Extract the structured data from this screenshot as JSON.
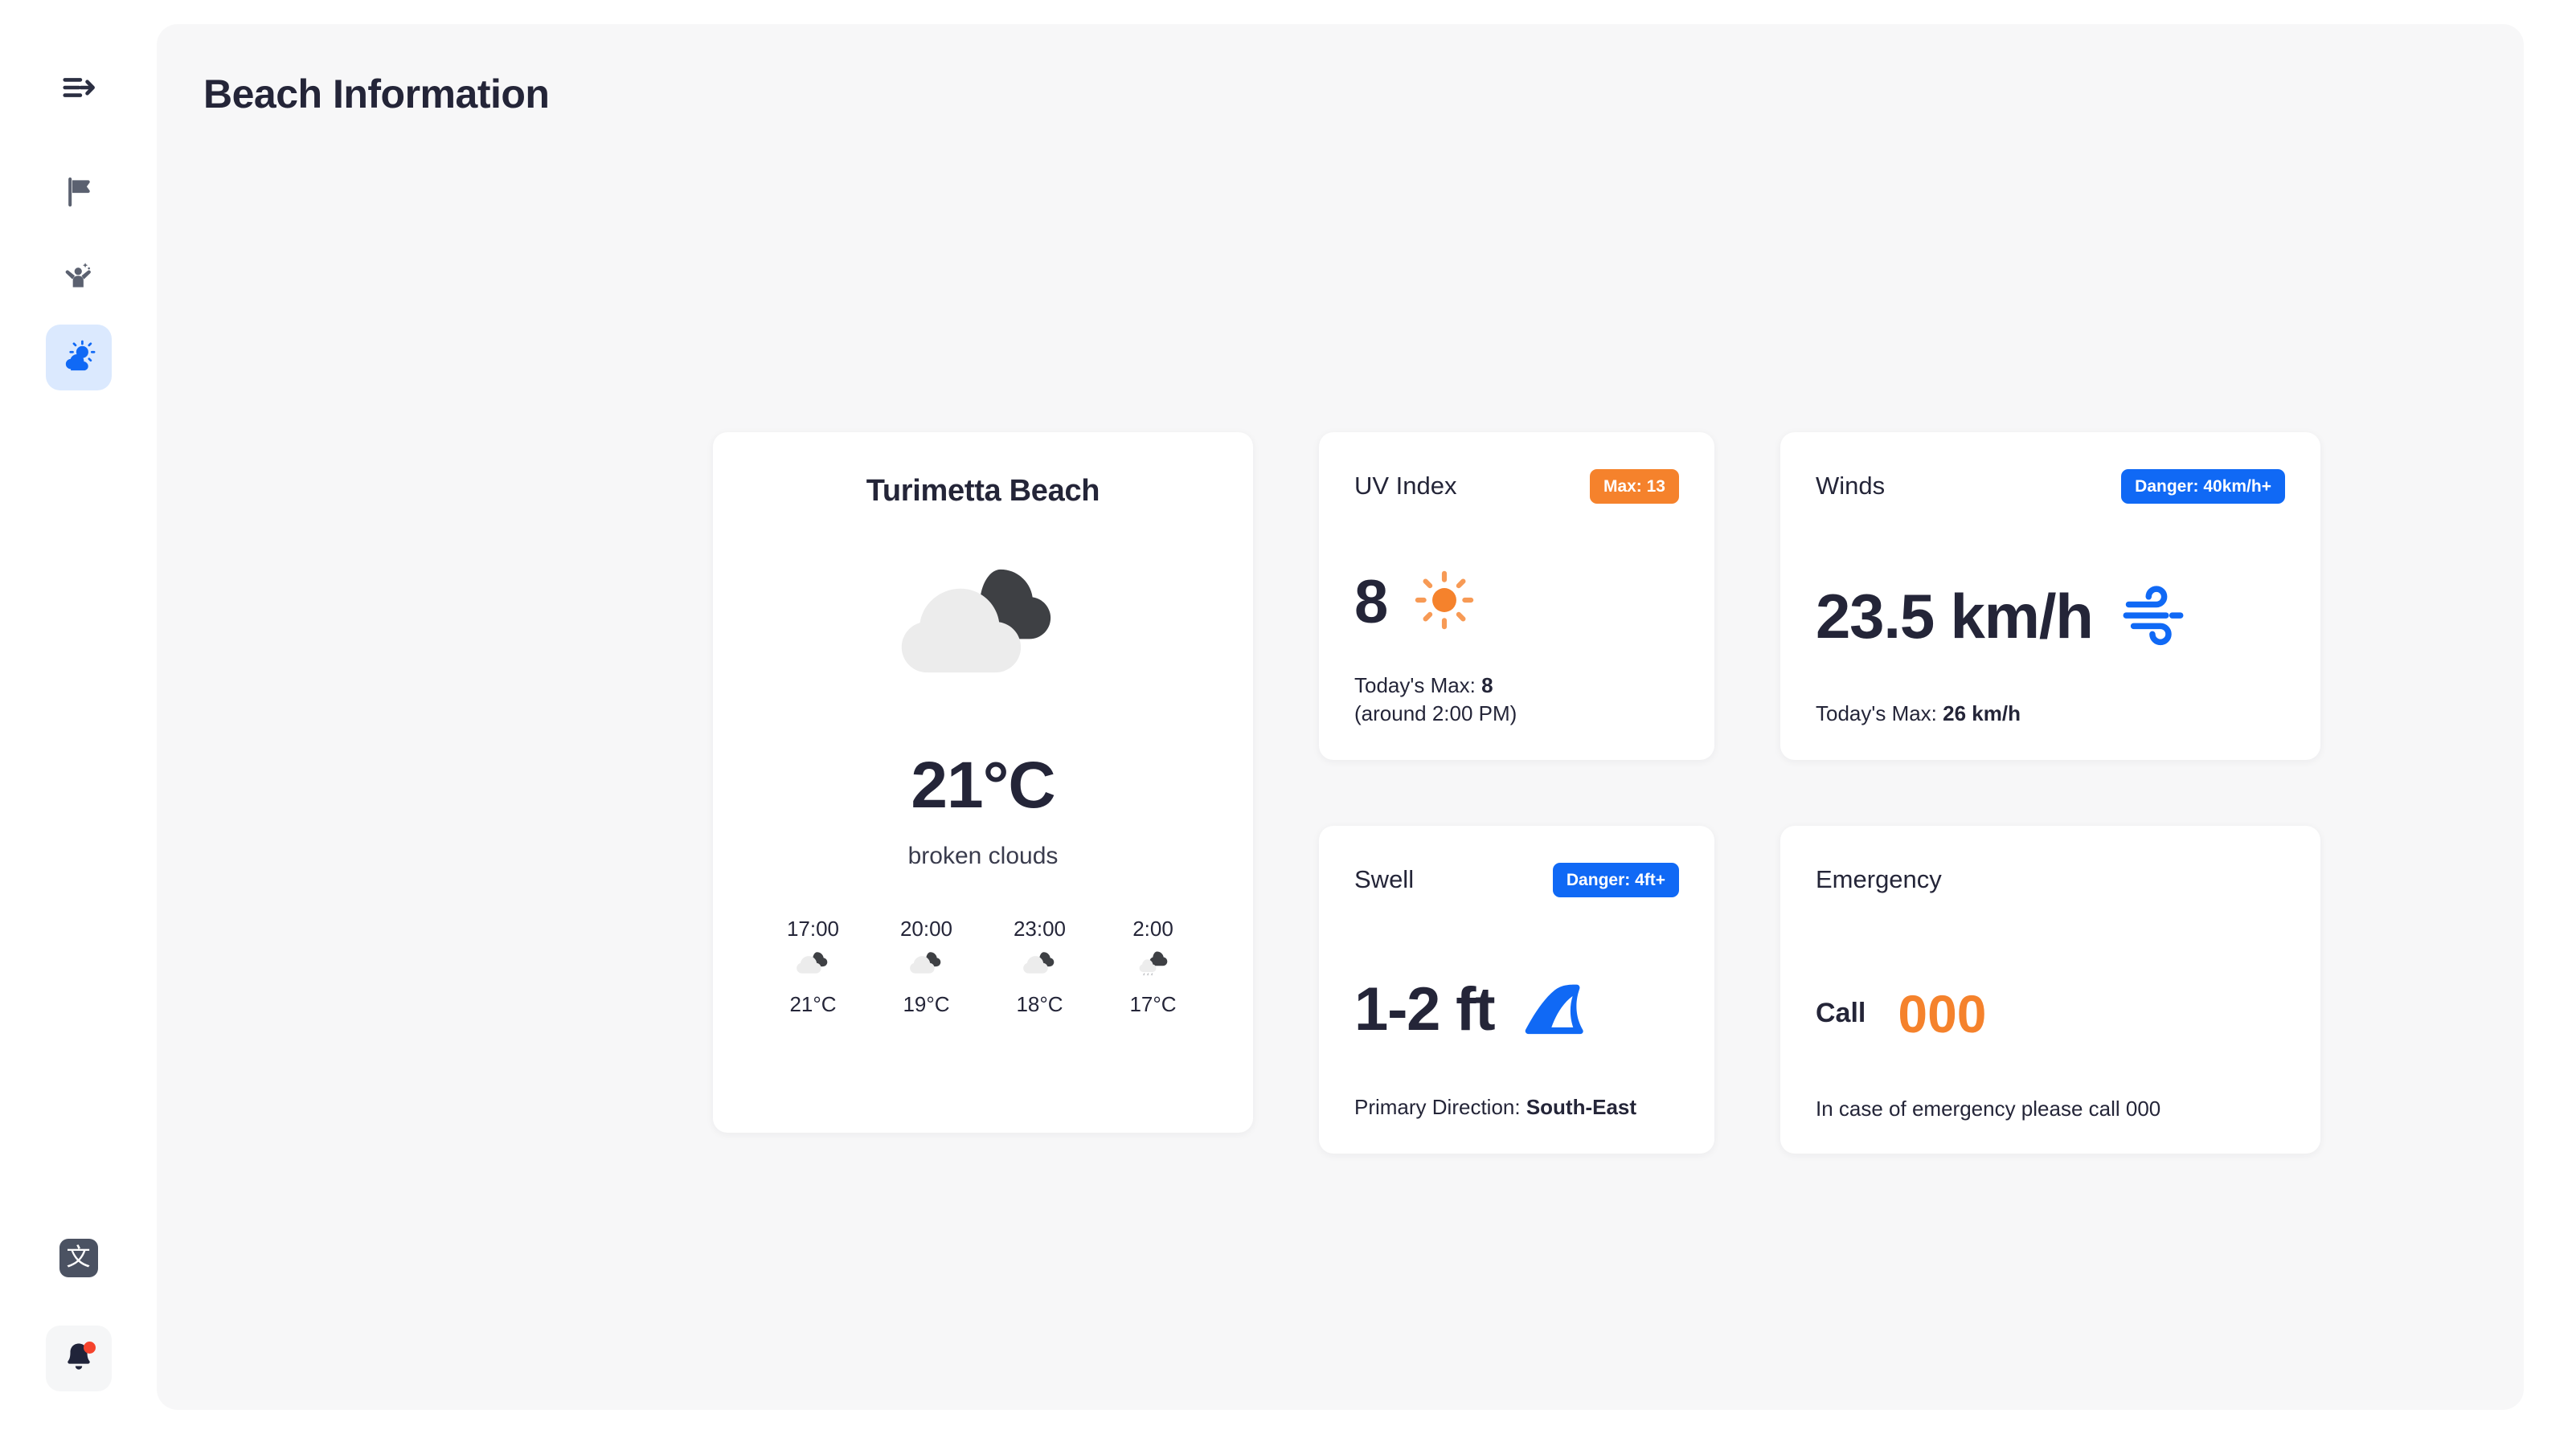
{
  "sidebar": {
    "toggle": {
      "icon": "menu-expand-arrow-icon",
      "label": "Toggle sidebar"
    },
    "items": [
      {
        "icon": "flag-icon",
        "label": "Flags",
        "active": false
      },
      {
        "icon": "person-raised-arms-icon",
        "label": "Lifeguard",
        "active": false
      },
      {
        "icon": "sun-behind-cloud-icon",
        "label": "Weather",
        "active": true
      }
    ],
    "language": {
      "icon": "translate-icon",
      "glyph": "文",
      "label": "Language"
    },
    "notifications": {
      "icon": "bell-icon",
      "label": "Notifications",
      "has_badge": true
    }
  },
  "header": {
    "title": "Beach Information"
  },
  "beach": {
    "name": "Turimetta Beach",
    "icon": "broken-clouds-icon",
    "temperature": "21°C",
    "description": "broken clouds",
    "hourly": [
      {
        "time": "17:00",
        "icon": "broken-clouds-icon",
        "temp": "21°C"
      },
      {
        "time": "20:00",
        "icon": "broken-clouds-icon",
        "temp": "19°C"
      },
      {
        "time": "23:00",
        "icon": "broken-clouds-icon",
        "temp": "18°C"
      },
      {
        "time": "2:00",
        "icon": "light-rain-icon",
        "temp": "17°C"
      }
    ]
  },
  "uv": {
    "title": "UV Index",
    "badge": "Max: 13",
    "badge_color": "#f5822c",
    "value": "8",
    "icon": "sun-icon",
    "footer_label": "Today's Max:",
    "footer_value": "8",
    "footer_note": "(around 2:00 PM)"
  },
  "winds": {
    "title": "Winds",
    "badge": "Danger: 40km/h+",
    "badge_color": "#1069f5",
    "value": "23.5 km/h",
    "icon": "wind-icon",
    "footer_label": "Today's Max:",
    "footer_value": "26 km/h"
  },
  "swell": {
    "title": "Swell",
    "badge": "Danger: 4ft+",
    "badge_color": "#1069f5",
    "value": "1-2 ft",
    "icon": "wave-icon",
    "footer_label": "Primary Direction:",
    "footer_value": "South-East"
  },
  "emergency": {
    "title": "Emergency",
    "call_label": "Call",
    "number": "000",
    "number_color": "#f5822c",
    "note": "In case of emergency please call 000"
  }
}
